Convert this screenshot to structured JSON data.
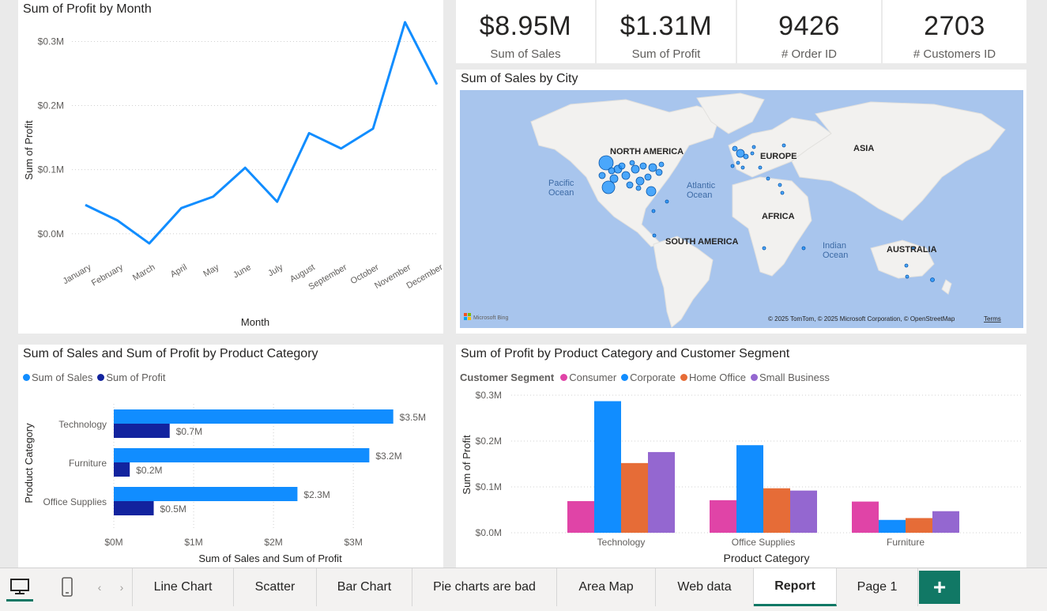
{
  "line_chart": {
    "title": "Sum of Profit by Month",
    "chart_data": {
      "type": "line",
      "categories": [
        "January",
        "February",
        "March",
        "April",
        "May",
        "June",
        "July",
        "August",
        "September",
        "October",
        "November",
        "December"
      ],
      "values": [
        0.045,
        0.021,
        -0.015,
        0.04,
        0.058,
        0.103,
        0.05,
        0.157,
        0.133,
        0.164,
        0.33,
        0.233
      ],
      "xlabel": "Month",
      "ylabel": "Sum of Profit",
      "yticks": [
        "$0.0M",
        "$0.1M",
        "$0.2M",
        "$0.3M"
      ],
      "ylim": [
        -0.02,
        0.34
      ],
      "color": "#118dff"
    }
  },
  "cards": [
    {
      "value": "$8.95M",
      "label": "Sum of Sales"
    },
    {
      "value": "$1.31M",
      "label": "Sum of Profit"
    },
    {
      "value": "9426",
      "label": "# Order ID"
    },
    {
      "value": "2703",
      "label": "# Customers ID"
    }
  ],
  "map": {
    "title": "Sum of Sales by City",
    "labels": {
      "north_america": "NORTH AMERICA",
      "south_america": "SOUTH AMERICA",
      "europe": "EUROPE",
      "asia": "ASIA",
      "africa": "AFRICA",
      "australia": "AUSTRALIA",
      "pacific": "Pacific\nOcean",
      "atlantic": "Atlantic\nOcean",
      "indian": "Indian\nOcean"
    },
    "attribution": "© 2025 TomTom, © 2025 Microsoft Corporation, © OpenStreetMap",
    "terms": "Terms",
    "logo": "Microsoft Bing"
  },
  "hbar_chart": {
    "title": "Sum of Sales and Sum of Profit by Product Category",
    "chart_data": {
      "type": "bar",
      "orientation": "horizontal",
      "categories": [
        "Technology",
        "Furniture",
        "Office Supplies"
      ],
      "series": [
        {
          "name": "Sum of Sales",
          "values": [
            3.5,
            3.2,
            2.3
          ],
          "labels": [
            "$3.5M",
            "$3.2M",
            "$2.3M"
          ],
          "color": "#118dff"
        },
        {
          "name": "Sum of Profit",
          "values": [
            0.7,
            0.2,
            0.5
          ],
          "labels": [
            "$0.7M",
            "$0.2M",
            "$0.5M"
          ],
          "color": "#12239e"
        }
      ],
      "xlabel": "Sum of Sales and Sum of Profit",
      "ylabel": "Product Category",
      "xticks": [
        "$0M",
        "$1M",
        "$2M",
        "$3M"
      ],
      "xlim": [
        0,
        3.8
      ]
    }
  },
  "col_chart": {
    "title": "Sum of Profit by Product Category and Customer Segment",
    "legend_title": "Customer Segment",
    "chart_data": {
      "type": "bar",
      "categories": [
        "Technology",
        "Office Supplies",
        "Furniture"
      ],
      "series": [
        {
          "name": "Consumer",
          "values": [
            0.069,
            0.071,
            0.068
          ],
          "color": "#e044a7"
        },
        {
          "name": "Corporate",
          "values": [
            0.287,
            0.191,
            0.028
          ],
          "color": "#118dff"
        },
        {
          "name": "Home Office",
          "values": [
            0.152,
            0.097,
            0.032
          ],
          "color": "#e66c37"
        },
        {
          "name": "Small Business",
          "values": [
            0.176,
            0.092,
            0.047
          ],
          "color": "#9467d0"
        }
      ],
      "xlabel": "Product Category",
      "ylabel": "Sum of Profit",
      "yticks": [
        "$0.0M",
        "$0.1M",
        "$0.2M",
        "$0.3M"
      ],
      "ylim": [
        0,
        0.3
      ]
    }
  },
  "tabs": {
    "items": [
      "Line Chart",
      "Scatter",
      "Bar Chart",
      "Pie charts are bad",
      "Area Map",
      "Web data",
      "Report",
      "Page 1"
    ],
    "active": "Report",
    "add_label": "+"
  },
  "colors": {
    "accent": "#117865",
    "primary": "#118dff",
    "dark": "#12239e"
  }
}
